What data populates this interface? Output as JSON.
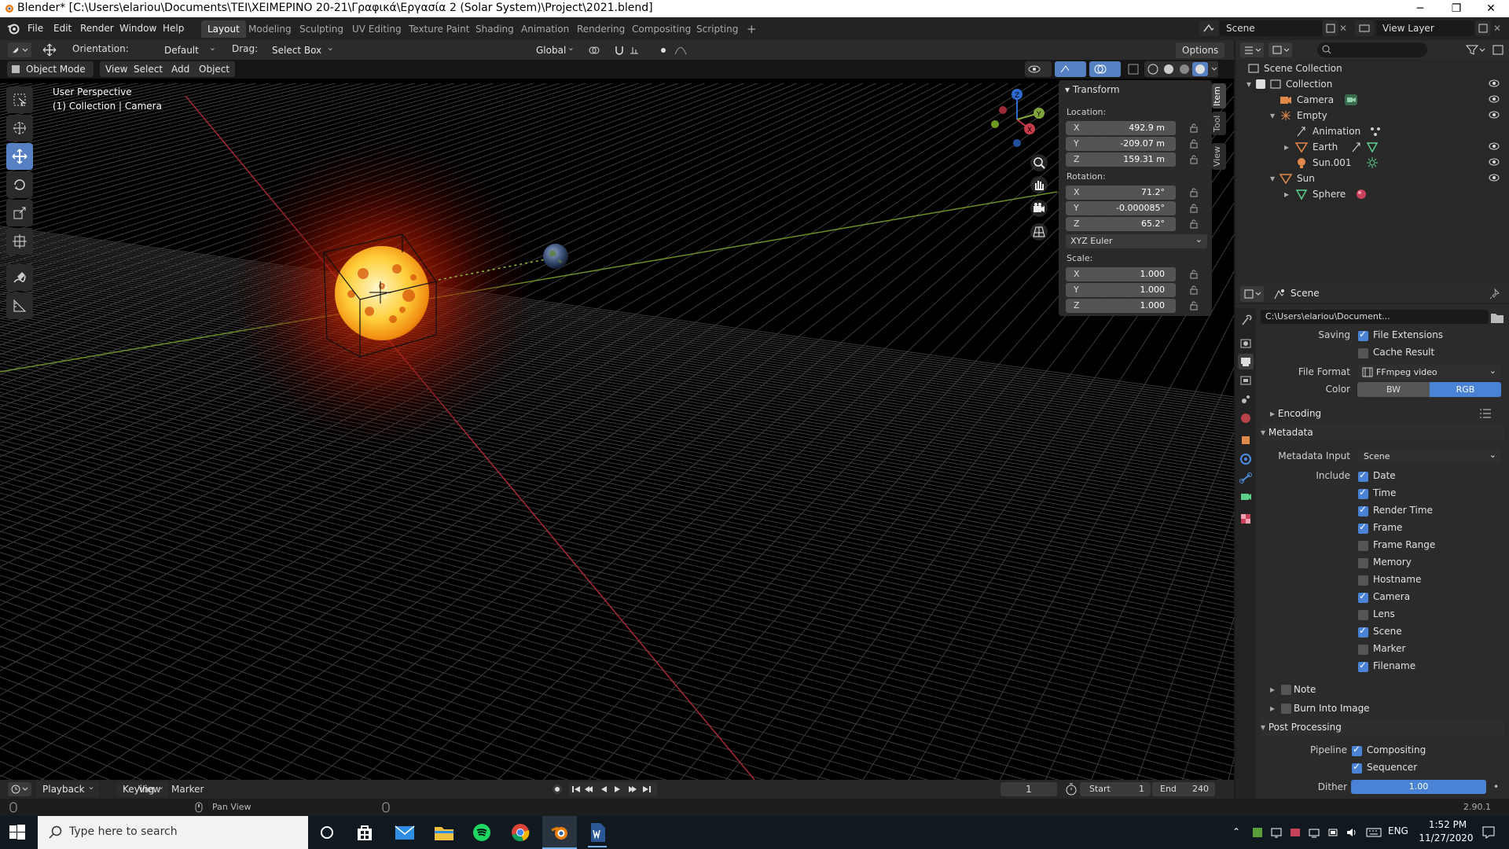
{
  "window": {
    "title": "Blender* [C:\\Users\\elariou\\Documents\\ΤΕΙ\\ΧΕΙΜΕΡΙΝΟ 20-21\\Γραφικά\\Εργασία 2 (Solar System)\\Project\\2021.blend]"
  },
  "menu": [
    "File",
    "Edit",
    "Render",
    "Window",
    "Help"
  ],
  "workspaces": [
    "Layout",
    "Modeling",
    "Sculpting",
    "UV Editing",
    "Texture Paint",
    "Shading",
    "Animation",
    "Rendering",
    "Compositing",
    "Scripting"
  ],
  "active_workspace": "Layout",
  "scene_field": "Scene",
  "view_layer_field": "View Layer",
  "tool_header": {
    "orientation_label": "Orientation:",
    "orientation_value": "Default",
    "drag_label": "Drag:",
    "drag_value": "Select Box",
    "transform_orientation": "Global",
    "options": "Options"
  },
  "viewport_header": {
    "mode": "Object Mode",
    "menus": [
      "View",
      "Select",
      "Add",
      "Object"
    ]
  },
  "viewport_overlay": {
    "line1": "User Perspective",
    "line2": "(1) Collection | Camera"
  },
  "transform": {
    "title": "Transform",
    "location_label": "Location:",
    "location": {
      "x": "492.9 m",
      "y": "-209.07 m",
      "z": "159.31 m"
    },
    "rotation_label": "Rotation:",
    "rotation": {
      "x": "71.2°",
      "y": "-0.000085°",
      "z": "65.2°"
    },
    "rotation_mode": "XYZ Euler",
    "scale_label": "Scale:",
    "scale": {
      "x": "1.000",
      "y": "1.000",
      "z": "1.000"
    },
    "tabs": [
      "Item",
      "Tool",
      "View"
    ]
  },
  "outliner": {
    "root": "Scene Collection",
    "rows": [
      {
        "label": "Collection"
      },
      {
        "label": "Camera"
      },
      {
        "label": "Empty"
      },
      {
        "label": "Animation"
      },
      {
        "label": "Earth"
      },
      {
        "label": "Sun.001"
      },
      {
        "label": "Sun"
      },
      {
        "label": "Sphere"
      }
    ]
  },
  "properties": {
    "context": "Scene",
    "output_path": "C:\\Users\\elariou\\Document...",
    "saving_label": "Saving",
    "file_extensions": "File Extensions",
    "cache_result": "Cache Result",
    "file_format_label": "File Format",
    "file_format": "FFmpeg video",
    "color_label": "Color",
    "color_bw": "BW",
    "color_rgb": "RGB",
    "encoding": "Encoding",
    "metadata": "Metadata",
    "metadata_input_label": "Metadata Input",
    "metadata_input": "Scene",
    "include_label": "Include",
    "include": [
      {
        "label": "Date",
        "checked": true
      },
      {
        "label": "Time",
        "checked": true
      },
      {
        "label": "Render Time",
        "checked": true
      },
      {
        "label": "Frame",
        "checked": true
      },
      {
        "label": "Frame Range",
        "checked": false
      },
      {
        "label": "Memory",
        "checked": false
      },
      {
        "label": "Hostname",
        "checked": false
      },
      {
        "label": "Camera",
        "checked": true
      },
      {
        "label": "Lens",
        "checked": false
      },
      {
        "label": "Scene",
        "checked": true
      },
      {
        "label": "Marker",
        "checked": false
      },
      {
        "label": "Filename",
        "checked": true
      }
    ],
    "note": "Note",
    "burn_into_image": "Burn Into Image",
    "post_processing": "Post Processing",
    "pipeline_label": "Pipeline",
    "compositing": "Compositing",
    "sequencer": "Sequencer",
    "dither_label": "Dither",
    "dither_value": "1.00"
  },
  "timeline": {
    "menus": [
      "Playback",
      "Keying",
      "View",
      "Marker"
    ],
    "current_frame": "1",
    "start_label": "Start",
    "start_value": "1",
    "end_label": "End",
    "end_value": "240"
  },
  "statusbar": {
    "hint": "Pan View",
    "version": "2.90.1"
  },
  "taskbar": {
    "search_placeholder": "Type here to search",
    "lang": "ENG",
    "time": "1:52 PM",
    "date": "11/27/2020"
  },
  "colors": {
    "accent_blue": "#4a83d6",
    "active_tool": "#5680c2",
    "x_axis": "#c83c4a",
    "y_axis": "#7fa53a"
  }
}
